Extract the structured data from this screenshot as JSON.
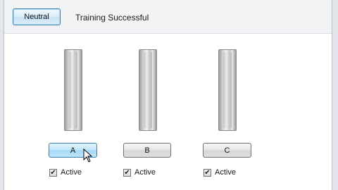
{
  "toolbar": {
    "neutral_label": "Neutral",
    "status": "Training Successful"
  },
  "channels": [
    {
      "label": "A",
      "active_label": "Active",
      "checked": true
    },
    {
      "label": "B",
      "active_label": "Active",
      "checked": true
    },
    {
      "label": "C",
      "active_label": "Active",
      "checked": true
    }
  ],
  "glyphs": {
    "check": "✔"
  }
}
